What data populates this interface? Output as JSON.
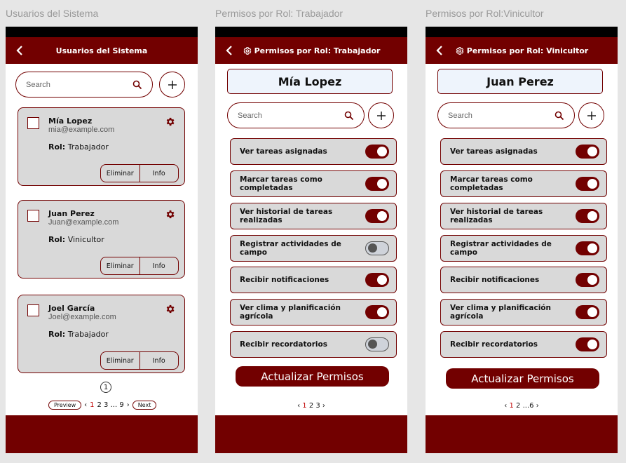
{
  "frames": [
    {
      "frame_title": "Usuarios del Sistema",
      "appbar_title": "Usuarios del Sistema",
      "search_placeholder": "Search",
      "users": [
        {
          "name": "Mía Lopez",
          "email": "mia@example.com",
          "role_label": "Rol:",
          "role": "Trabajador",
          "delete": "Eliminar",
          "info": "Info"
        },
        {
          "name": "Juan Perez",
          "email": "Juan@example.com",
          "role_label": "Rol:",
          "role": "Vinicultor",
          "delete": "Eliminar",
          "info": "Info"
        },
        {
          "name": "Joel García",
          "email": "Joel@example.com",
          "role_label": "Rol:",
          "role": "Trabajador",
          "delete": "Eliminar",
          "info": "Info"
        }
      ],
      "current_page": "1",
      "pagination": {
        "preview": "Preview",
        "next": "Next",
        "prev_arrow": "‹",
        "next_arrow": "›",
        "active": "1",
        "rest": "2 3 ... 9"
      }
    },
    {
      "frame_title": "Permisos por Rol: Trabajador",
      "appbar_title": "Permisos por Rol: Trabajador",
      "user_name": "Mía Lopez",
      "search_placeholder": "Search",
      "permissions": [
        {
          "label": "Ver tareas asignadas",
          "enabled": true
        },
        {
          "label": "Marcar tareas como completadas",
          "enabled": true
        },
        {
          "label": "Ver historial de tareas realizadas",
          "enabled": true
        },
        {
          "label": "Registrar actividades de campo",
          "enabled": false
        },
        {
          "label": "Recibir notificaciones",
          "enabled": true
        },
        {
          "label": "Ver clima y planificación agrícola",
          "enabled": true
        },
        {
          "label": "Recibir recordatorios",
          "enabled": false
        }
      ],
      "update_button": "Actualizar Permisos",
      "pagination": {
        "prev_arrow": "‹",
        "active": "1",
        "rest": "2 3",
        "next_arrow": "›"
      }
    },
    {
      "frame_title": "Permisos por Rol:Vinicultor",
      "appbar_title": "Permisos por Rol: Vinicultor",
      "user_name": "Juan Perez",
      "search_placeholder": "Search",
      "permissions": [
        {
          "label": "Ver tareas asignadas",
          "enabled": true
        },
        {
          "label": "Marcar tareas como completadas",
          "enabled": true
        },
        {
          "label": "Ver historial de tareas realizadas",
          "enabled": true
        },
        {
          "label": "Registrar actividades de campo",
          "enabled": true
        },
        {
          "label": "Recibir notificaciones",
          "enabled": true
        },
        {
          "label": "Ver clima y planificación agrícola",
          "enabled": true
        },
        {
          "label": "Recibir recordatorios",
          "enabled": true
        }
      ],
      "update_button": "Actualizar Permisos",
      "pagination": {
        "prev_arrow": "‹",
        "active": "1",
        "rest": "2 ...6",
        "next_arrow": "›"
      }
    }
  ],
  "colors": {
    "primary": "#720000",
    "card": "#d9d9d9",
    "name_box": "#eef4fc",
    "page_active": "#c00000"
  },
  "icons": {
    "back": "chevron-left-icon",
    "search": "search-icon",
    "add": "plus-icon",
    "settings": "gear-icon"
  }
}
